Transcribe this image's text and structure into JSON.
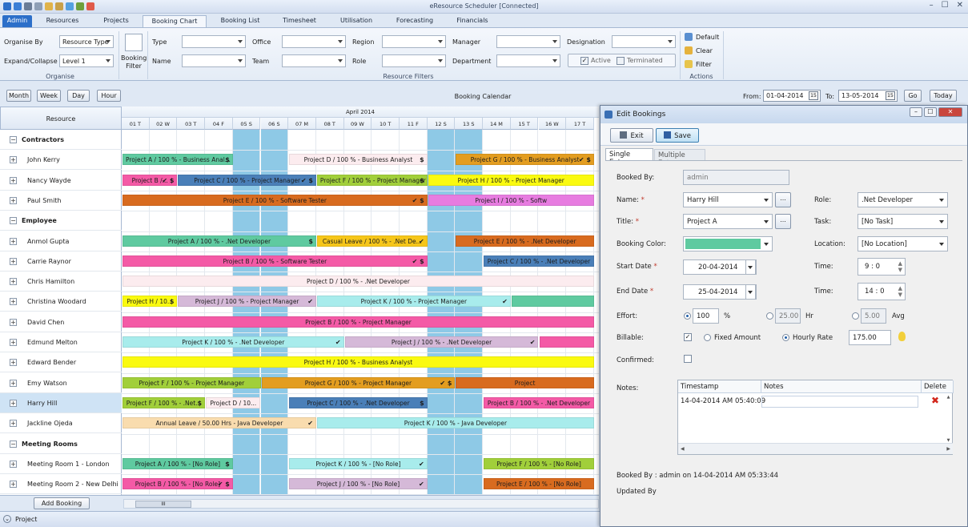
{
  "window": {
    "title": "eResource Scheduler [Connected]"
  },
  "ribbon_tabs": [
    "Admin",
    "Resources",
    "Projects",
    "Booking Chart",
    "Booking List",
    "Timesheet",
    "Utilisation",
    "Forecasting",
    "Financials"
  ],
  "organise": {
    "organise_by_label": "Organise By",
    "organise_by_value": "Resource Type",
    "expand_label": "Expand/Collapse",
    "expand_value": "Level 1",
    "group_title": "Organise",
    "booking_filter_label": "Booking Filter"
  },
  "filters": {
    "type": "Type",
    "name": "Name",
    "office": "Office",
    "team": "Team",
    "region": "Region",
    "role": "Role",
    "manager": "Manager",
    "department": "Department",
    "designation": "Designation",
    "active": "Active",
    "terminated": "Terminated",
    "group_title": "Resource Filters"
  },
  "actions": {
    "default": "Default",
    "clear": "Clear",
    "filter": "Filter",
    "group_title": "Actions"
  },
  "calendar_toolbar": {
    "month": "Month",
    "week": "Week",
    "day": "Day",
    "hour": "Hour",
    "title": "Booking Calendar",
    "from_label": "From:",
    "from_value": "01-04-2014",
    "to_label": "To:",
    "to_value": "13-05-2014",
    "go": "Go",
    "today": "Today",
    "cal_icon": "15"
  },
  "resource_header": "Resource",
  "resources": [
    {
      "name": "Contractors",
      "group": true
    },
    {
      "name": "John Kerry"
    },
    {
      "name": "Nancy Wayde"
    },
    {
      "name": "Paul Smith"
    },
    {
      "name": "Employee",
      "group": true
    },
    {
      "name": "Anmol Gupta"
    },
    {
      "name": "Carrie Raynor"
    },
    {
      "name": "Chris Hamilton"
    },
    {
      "name": "Christina Woodard"
    },
    {
      "name": "David Chen"
    },
    {
      "name": "Edmund Melton"
    },
    {
      "name": "Edward Bender"
    },
    {
      "name": "Emy Watson"
    },
    {
      "name": "Harry Hill",
      "selected": true
    },
    {
      "name": "Jackline Ojeda"
    },
    {
      "name": "Meeting Rooms",
      "group": true
    },
    {
      "name": "Meeting Room 1 - London"
    },
    {
      "name": "Meeting Room 2 - New Delhi"
    }
  ],
  "calendar": {
    "month_label": "April 2014",
    "days": [
      "01 T",
      "02 W",
      "03 T",
      "04 F",
      "05 S",
      "06 S",
      "07 M",
      "08 T",
      "09 W",
      "10 T",
      "11 F",
      "12 S",
      "13 S",
      "14 M",
      "15 T",
      "16 W",
      "17 T"
    ],
    "weekend_days": [
      4,
      5,
      11,
      12
    ]
  },
  "bookings": [
    {
      "row": 1,
      "start": 0,
      "end": 4,
      "text": "Project A / 100 % - Business Anal...",
      "mark": "$",
      "color": "#5fcaa0"
    },
    {
      "row": 1,
      "start": 6,
      "end": 11,
      "text": "Project D / 100 % - Business Analyst",
      "mark": "$",
      "color": "#fcecef"
    },
    {
      "row": 1,
      "start": 12,
      "end": 17,
      "text": "Project G / 100 % - Business Analyst",
      "mark": "✔ $",
      "color": "#e39d20"
    },
    {
      "row": 2,
      "start": 0,
      "end": 2,
      "text": "Project B /...",
      "mark": "✔ $",
      "color": "#f45aa6"
    },
    {
      "row": 2,
      "start": 2,
      "end": 7,
      "text": "Project C / 100 % - Project Manager",
      "mark": "✔ $",
      "color": "#4a7fb8"
    },
    {
      "row": 2,
      "start": 7,
      "end": 11,
      "text": "Project F / 100 % - Project Manager",
      "mark": "$",
      "color": "#a1cf3a"
    },
    {
      "row": 2,
      "start": 11,
      "end": 17,
      "text": "Project H / 100 % - Project Manager",
      "mark": "",
      "color": "#fafa10"
    },
    {
      "row": 3,
      "start": 0,
      "end": 11,
      "text": "Project E / 100 % - Software Tester",
      "mark": "✔ $",
      "color": "#d86b1f"
    },
    {
      "row": 3,
      "start": 11,
      "end": 17,
      "text": "Project I / 100 % - Softw",
      "mark": "",
      "color": "#e77ce0"
    },
    {
      "row": 5,
      "start": 0,
      "end": 7,
      "text": "Project A / 100 % - .Net Developer",
      "mark": "$",
      "color": "#5fcaa0"
    },
    {
      "row": 5,
      "start": 7,
      "end": 11,
      "text": "Casual Leave / 100 % - .Net De...",
      "mark": "✔",
      "color": "#f6c619"
    },
    {
      "row": 5,
      "start": 12,
      "end": 17,
      "text": "Project E / 100 % - .Net Developer",
      "mark": "",
      "color": "#d86b1f"
    },
    {
      "row": 6,
      "start": 0,
      "end": 11,
      "text": "Project B / 100 % - Software Tester",
      "mark": "✔ $",
      "color": "#f45aa6"
    },
    {
      "row": 6,
      "start": 13,
      "end": 17,
      "text": "Project C / 100 % - .Net Developer",
      "mark": "",
      "color": "#4a7fb8"
    },
    {
      "row": 7,
      "start": 0,
      "end": 17,
      "text": "Project D / 100 % - .Net Developer",
      "mark": "",
      "color": "#fcecef"
    },
    {
      "row": 8,
      "start": 0,
      "end": 2,
      "text": "Project H / 10...",
      "mark": "$",
      "color": "#fafa10"
    },
    {
      "row": 8,
      "start": 2,
      "end": 7,
      "text": "Project J / 100 % - Project Manager",
      "mark": "✔",
      "color": "#d5b9d8"
    },
    {
      "row": 8,
      "start": 7,
      "end": 14,
      "text": "Project K / 100 % - Project Manager",
      "mark": "✔",
      "color": "#a8ecec"
    },
    {
      "row": 8,
      "start": 14,
      "end": 17,
      "text": "",
      "mark": "",
      "color": "#5fcaa0"
    },
    {
      "row": 9,
      "start": 0,
      "end": 17,
      "text": "Project B / 100 % - Project Manager",
      "mark": "",
      "color": "#f45aa6"
    },
    {
      "row": 10,
      "start": 0,
      "end": 8,
      "text": "Project K / 100 % - .Net Developer",
      "mark": "✔",
      "color": "#a8ecec"
    },
    {
      "row": 10,
      "start": 8,
      "end": 15,
      "text": "Project J / 100 % - .Net Developer",
      "mark": "✔",
      "color": "#d5b9d8"
    },
    {
      "row": 10,
      "start": 15,
      "end": 17,
      "text": "",
      "mark": "",
      "color": "#f45aa6"
    },
    {
      "row": 11,
      "start": 0,
      "end": 17,
      "text": "Project H / 100 % - Business Analyst",
      "mark": "",
      "color": "#fafa10"
    },
    {
      "row": 12,
      "start": 0,
      "end": 5,
      "text": "Project F / 100 % - Project Manager",
      "mark": "",
      "color": "#a1cf3a"
    },
    {
      "row": 12,
      "start": 5,
      "end": 12,
      "text": "Project G / 100 % - Project Manager",
      "mark": "✔ $",
      "color": "#e39d20"
    },
    {
      "row": 12,
      "start": 12,
      "end": 17,
      "text": "Project",
      "mark": "",
      "color": "#d86b1f"
    },
    {
      "row": 13,
      "start": 0,
      "end": 3,
      "text": "Project F / 100 % - .Net...",
      "mark": "$",
      "color": "#a1cf3a"
    },
    {
      "row": 13,
      "start": 3,
      "end": 5,
      "text": "Project D / 10...",
      "mark": "",
      "color": "#fcecef"
    },
    {
      "row": 13,
      "start": 6,
      "end": 11,
      "text": "Project C / 100 % - .Net Developer",
      "mark": "$",
      "color": "#4a7fb8"
    },
    {
      "row": 13,
      "start": 13,
      "end": 17,
      "text": "Project B / 100 % - .Net Developer",
      "mark": "",
      "color": "#f45aa6"
    },
    {
      "row": 14,
      "start": 0,
      "end": 7,
      "text": "Annual Leave / 50.00 Hrs - Java Developer",
      "mark": "✔",
      "color": "#f9dcae"
    },
    {
      "row": 14,
      "start": 7,
      "end": 17,
      "text": "Project K / 100 % - Java Developer",
      "mark": "",
      "color": "#a8ecec"
    },
    {
      "row": 16,
      "start": 0,
      "end": 4,
      "text": "Project A / 100 % - [No Role]",
      "mark": "$",
      "color": "#5fcaa0"
    },
    {
      "row": 16,
      "start": 6,
      "end": 11,
      "text": "Project K / 100 % - [No Role]",
      "mark": "✔",
      "color": "#a8ecec"
    },
    {
      "row": 16,
      "start": 13,
      "end": 17,
      "text": "Project F / 100 % - [No Role]",
      "mark": "",
      "color": "#a1cf3a"
    },
    {
      "row": 17,
      "start": 0,
      "end": 4,
      "text": "Project B / 100 % - [No Role]",
      "mark": "✔ $",
      "color": "#f45aa6"
    },
    {
      "row": 17,
      "start": 6,
      "end": 11,
      "text": "Project J / 100 % - [No Role]",
      "mark": "✔",
      "color": "#d5b9d8"
    },
    {
      "row": 17,
      "start": 13,
      "end": 17,
      "text": "Project E / 100 % - [No Role]",
      "mark": "",
      "color": "#d86b1f"
    }
  ],
  "add_booking": "Add Booking",
  "scroll_thumb": "III",
  "status": {
    "text": "Project"
  },
  "dialog": {
    "title": "Edit Bookings",
    "exit": "Exit",
    "save": "Save",
    "tab_single": "Single Entry",
    "tab_multiple": "Multiple Entry",
    "booked_by_label": "Booked By:",
    "booked_by_value": "admin",
    "name_label": "Name:",
    "name_value": "Harry Hill",
    "title_label": "Title:",
    "title_value": "Project A",
    "booking_color_label": "Booking Color:",
    "booking_color": "#5fcaa0",
    "start_date_label": "Start Date",
    "start_date": "20-04-2014",
    "end_date_label": "End Date",
    "end_date": "25-04-2014",
    "effort_label": "Effort:",
    "effort_value": "100",
    "effort_pct": "%",
    "effort_hr": "25.00",
    "hr_label": "Hr",
    "effort_avg": "5.00",
    "avg_label": "Avg",
    "billable_label": "Billable:",
    "fixed_amount": "Fixed Amount",
    "hourly_rate": "Hourly Rate",
    "rate_value": "175.00",
    "confirmed_label": "Confirmed:",
    "role_label": "Role:",
    "role_value": ".Net Developer",
    "task_label": "Task:",
    "task_value": "[No Task]",
    "location_label": "Location:",
    "location_value": "[No Location]",
    "time_label": "Time:",
    "start_time": "9 : 0",
    "end_time": "14 : 0",
    "notes_label": "Notes:",
    "notes_cols": [
      "Timestamp",
      "Notes",
      "Delete"
    ],
    "notes_rows": [
      {
        "timestamp": "14-04-2014 AM 05:40:09",
        "note": ""
      }
    ],
    "booked_by_footer": "Booked By : admin on 14-04-2014 AM 05:33:44",
    "updated_by": "Updated By",
    "ellipsis": "..."
  }
}
